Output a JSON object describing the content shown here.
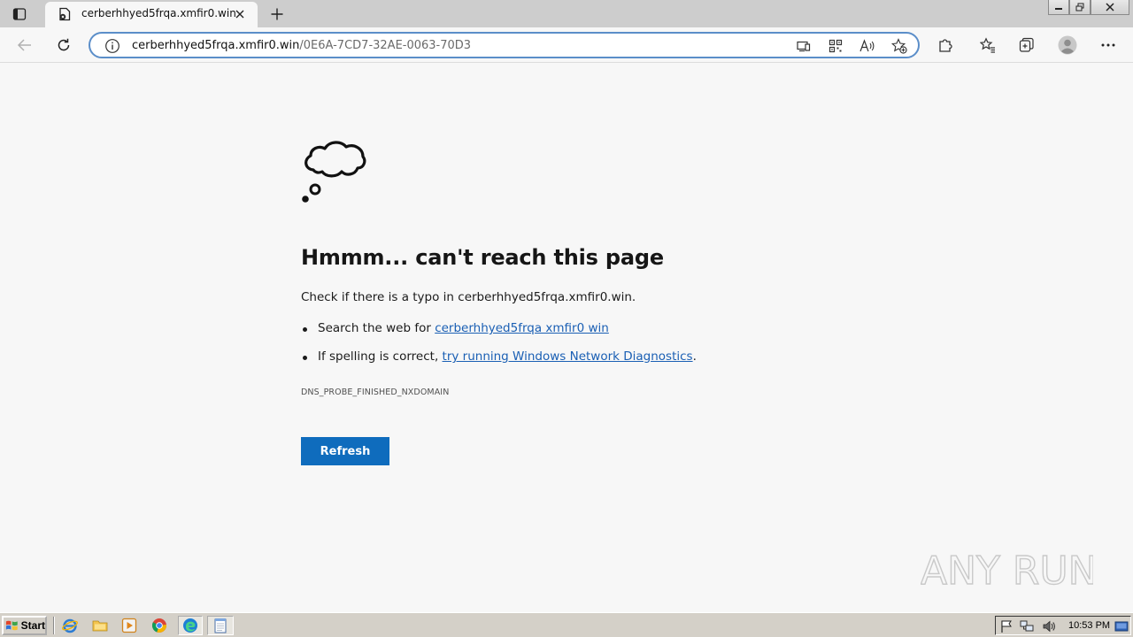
{
  "browser": {
    "tab": {
      "title": "cerberhhyed5frqa.xmfir0.win"
    },
    "address": {
      "host": "cerberhhyed5frqa.xmfir0.win",
      "path": "/0E6A-7CD7-32AE-0063-70D3"
    }
  },
  "page": {
    "heading": "Hmmm... can't reach this page",
    "typo_prefix": "Check if there is a typo in ",
    "typo_domain": "cerberhhyed5frqa.xmfir0.win",
    "typo_suffix": ".",
    "suggestions": [
      {
        "prefix": "Search the web for ",
        "link": "cerberhhyed5frqa xmfir0 win",
        "suffix": ""
      },
      {
        "prefix": "If spelling is correct, ",
        "link": "try running Windows Network Diagnostics",
        "suffix": "."
      }
    ],
    "error_code": "DNS_PROBE_FINISHED_NXDOMAIN",
    "refresh_label": "Refresh"
  },
  "watermark": "ANY RUN",
  "taskbar": {
    "start_label": "Start",
    "clock": "10:53 PM"
  },
  "colors": {
    "accent": "#0f6cbd",
    "link": "#1a5fb4",
    "address_border": "#5b8ec9",
    "taskbar": "#d4d0c8"
  },
  "icons": {
    "tab_actions": "tab-actions-icon",
    "favicon": "document-error-icon",
    "cloud": "thought-cloud-icon",
    "ie": "internet-explorer-icon",
    "explorer": "folder-icon",
    "media": "media-player-icon",
    "chrome": "chrome-icon",
    "edge": "edge-icon",
    "notepad": "notepad-icon"
  }
}
